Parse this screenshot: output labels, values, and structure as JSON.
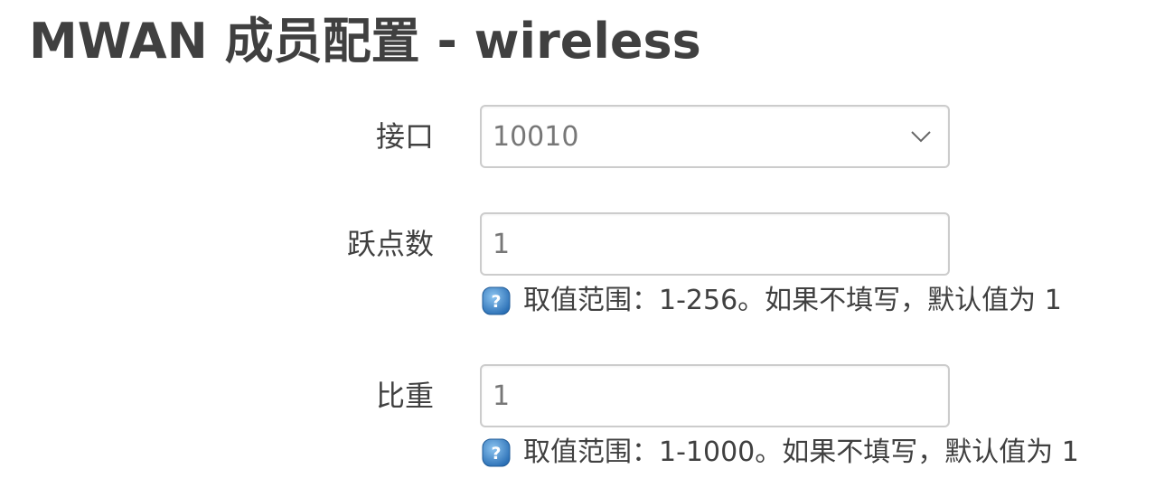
{
  "page": {
    "title": "MWAN 成员配置 - wireless"
  },
  "form": {
    "interface": {
      "label": "接口",
      "value": "10010",
      "icon": "chevron-down-icon"
    },
    "metric": {
      "label": "跃点数",
      "value": "1",
      "help": "取值范围：1-256。如果不填写，默认值为 1",
      "help_icon": "help-question-icon"
    },
    "weight": {
      "label": "比重",
      "value": "1",
      "help": "取值范围：1-1000。如果不填写，默认值为 1",
      "help_icon": "help-question-icon"
    }
  },
  "colors": {
    "text": "#404040",
    "input_border": "#cccccc",
    "input_text": "#777777",
    "help_icon_blue": "#3a87c7"
  }
}
